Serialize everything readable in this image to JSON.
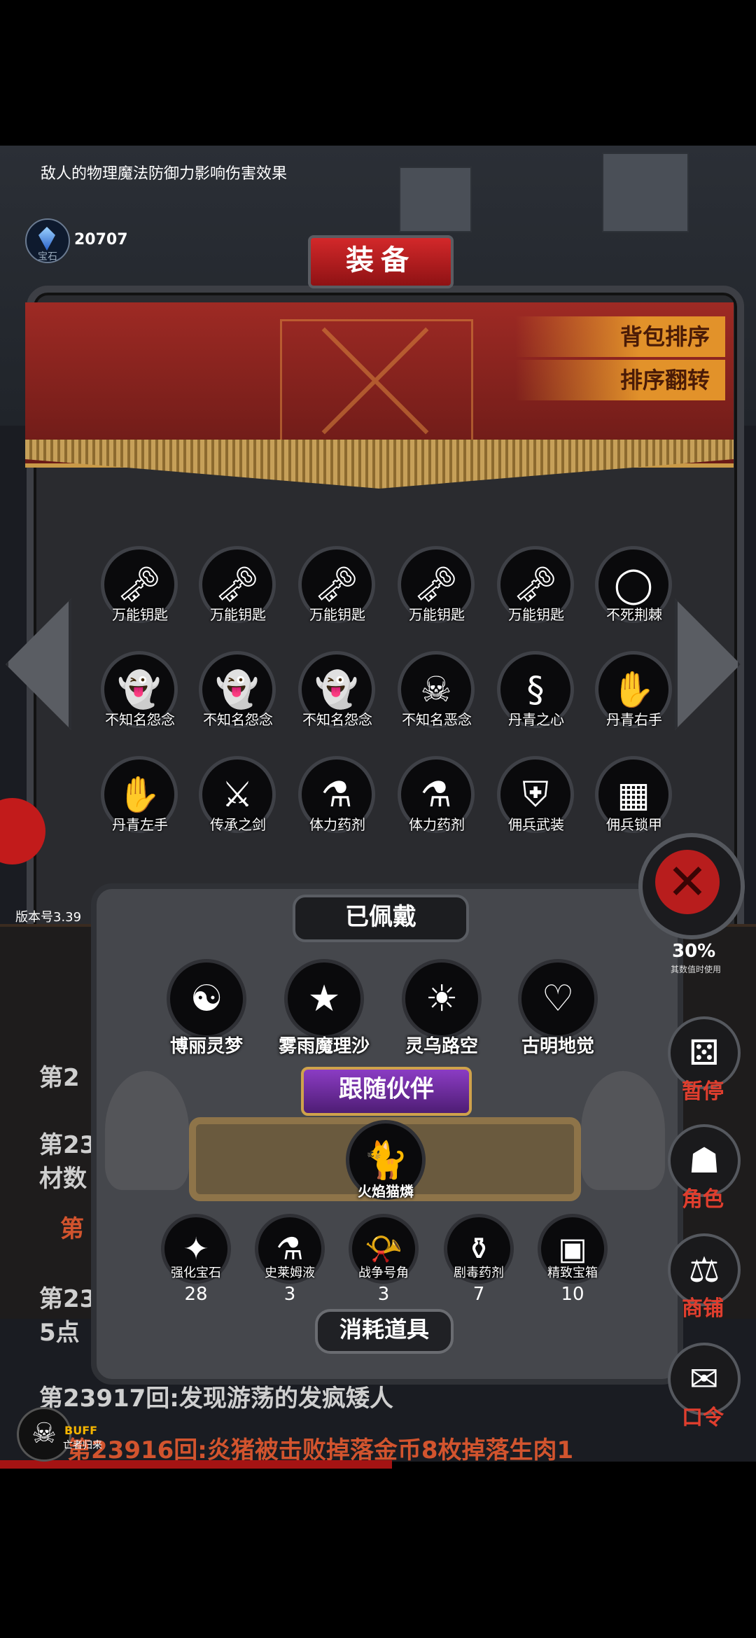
{
  "tip_text": "敌人的物理魔法防御力影响伤害效果",
  "currency": {
    "label": "宝石",
    "value": "20707"
  },
  "panel": {
    "title": "装备",
    "sort_label": "背包排序",
    "reverse_label": "排序翻转"
  },
  "items": [
    {
      "label": "万能钥匙",
      "icon": "key-icon",
      "glyph": "🗝"
    },
    {
      "label": "万能钥匙",
      "icon": "key-icon",
      "glyph": "🗝"
    },
    {
      "label": "万能钥匙",
      "icon": "key-icon",
      "glyph": "🗝"
    },
    {
      "label": "万能钥匙",
      "icon": "key-icon",
      "glyph": "🗝"
    },
    {
      "label": "万能钥匙",
      "icon": "key-icon",
      "glyph": "🗝"
    },
    {
      "label": "不死荆棘",
      "icon": "thorn-wreath-icon",
      "glyph": "◯"
    },
    {
      "label": "不知名怨念",
      "icon": "ghost-icon",
      "glyph": "👻"
    },
    {
      "label": "不知名怨念",
      "icon": "ghost-icon",
      "glyph": "👻"
    },
    {
      "label": "不知名怨念",
      "icon": "ghost-icon",
      "glyph": "👻"
    },
    {
      "label": "不知名恶念",
      "icon": "specter-icon",
      "glyph": "☠"
    },
    {
      "label": "丹青之心",
      "icon": "serpent-icon",
      "glyph": "§"
    },
    {
      "label": "丹青右手",
      "icon": "gauntlet-icon",
      "glyph": "✋"
    },
    {
      "label": "丹青左手",
      "icon": "gauntlet-icon",
      "glyph": "✋"
    },
    {
      "label": "传承之剑",
      "icon": "sword-icon",
      "glyph": "⚔"
    },
    {
      "label": "体力药剂",
      "icon": "potion-icon",
      "glyph": "⚗"
    },
    {
      "label": "体力药剂",
      "icon": "potion-icon",
      "glyph": "⚗"
    },
    {
      "label": "佣兵武装",
      "icon": "helmet-axe-icon",
      "glyph": "⛨"
    },
    {
      "label": "佣兵锁甲",
      "icon": "chainmail-icon",
      "glyph": "▦"
    }
  ],
  "version": "版本号3.39",
  "log": [
    "第2",
    "第23",
    "材数",
    "第",
    "第23",
    "5点",
    "第23917回:发现游荡的发疯矮人",
    "第23916回:炎猪被击败掉落金币8枚掉落生肉1"
  ],
  "equipped": {
    "title": "已佩戴",
    "heroes": [
      {
        "name": "博丽灵梦",
        "glyph": "☯"
      },
      {
        "name": "雾雨魔理沙",
        "glyph": "★"
      },
      {
        "name": "灵乌路空",
        "glyph": "☀"
      },
      {
        "name": "古明地觉",
        "glyph": "♡"
      }
    ],
    "companion_title": "跟随伙伴",
    "companion": {
      "name": "火焰猫燐",
      "glyph": "🐈"
    },
    "consumables_title": "消耗道具",
    "consumables": [
      {
        "label": "强化宝石",
        "count": "28",
        "glyph": "✦"
      },
      {
        "label": "史莱姆液",
        "count": "3",
        "glyph": "⚗"
      },
      {
        "label": "战争号角",
        "count": "3",
        "glyph": "📯"
      },
      {
        "label": "剧毒药剂",
        "count": "7",
        "glyph": "⚱"
      },
      {
        "label": "精致宝箱",
        "count": "10",
        "glyph": "▣"
      }
    ]
  },
  "side_buttons": [
    {
      "label": "暂停",
      "icon": "dice-icon",
      "glyph": "⚄"
    },
    {
      "label": "角色",
      "icon": "hooded-figure-icon",
      "glyph": "☗"
    },
    {
      "label": "商铺",
      "icon": "shop-icon",
      "glyph": "⚖"
    },
    {
      "label": "口令",
      "icon": "scroll-icon",
      "glyph": "✉"
    }
  ],
  "speed": {
    "value": "30%",
    "note": "其数值时使用"
  },
  "buff": {
    "label": "BUFF",
    "sub": "亡者归来"
  }
}
